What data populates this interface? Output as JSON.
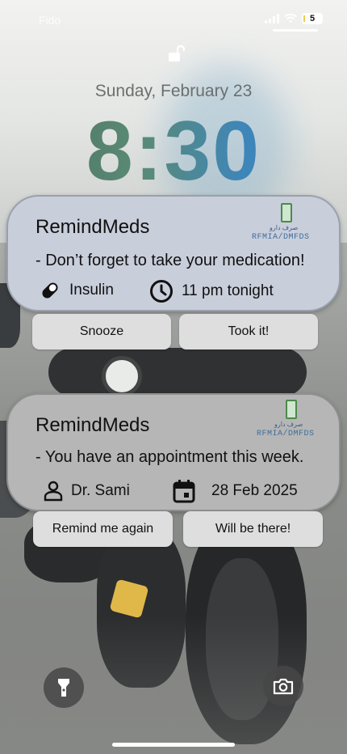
{
  "status_bar": {
    "carrier": "Fido",
    "battery": "5"
  },
  "lock_screen": {
    "date": "Sunday, February 23",
    "time": "8:30"
  },
  "notifications": [
    {
      "app_name": "RemindMeds",
      "logo_text": "RFMIA/DMFDS",
      "logo_small_text": "صرف دارو",
      "message": "- Don’t forget to take your medication!",
      "detail_1": "Insulin",
      "detail_1_icon": "pill-icon",
      "detail_2": "11 pm tonight",
      "detail_2_icon": "clock-icon",
      "actions": [
        "Snooze",
        "Took it!"
      ]
    },
    {
      "app_name": "RemindMeds",
      "logo_text": "RFMIA/DMFDS",
      "logo_small_text": "صرف دارو",
      "message": "- You have an appointment this week.",
      "detail_1": "Dr. Sami",
      "detail_1_icon": "person-icon",
      "detail_2": "28 Feb 2025",
      "detail_2_icon": "calendar-icon",
      "actions": [
        "Remind me again",
        "Will be there!"
      ]
    }
  ],
  "bottom_controls": {
    "left": "flashlight-icon",
    "right": "camera-icon"
  }
}
